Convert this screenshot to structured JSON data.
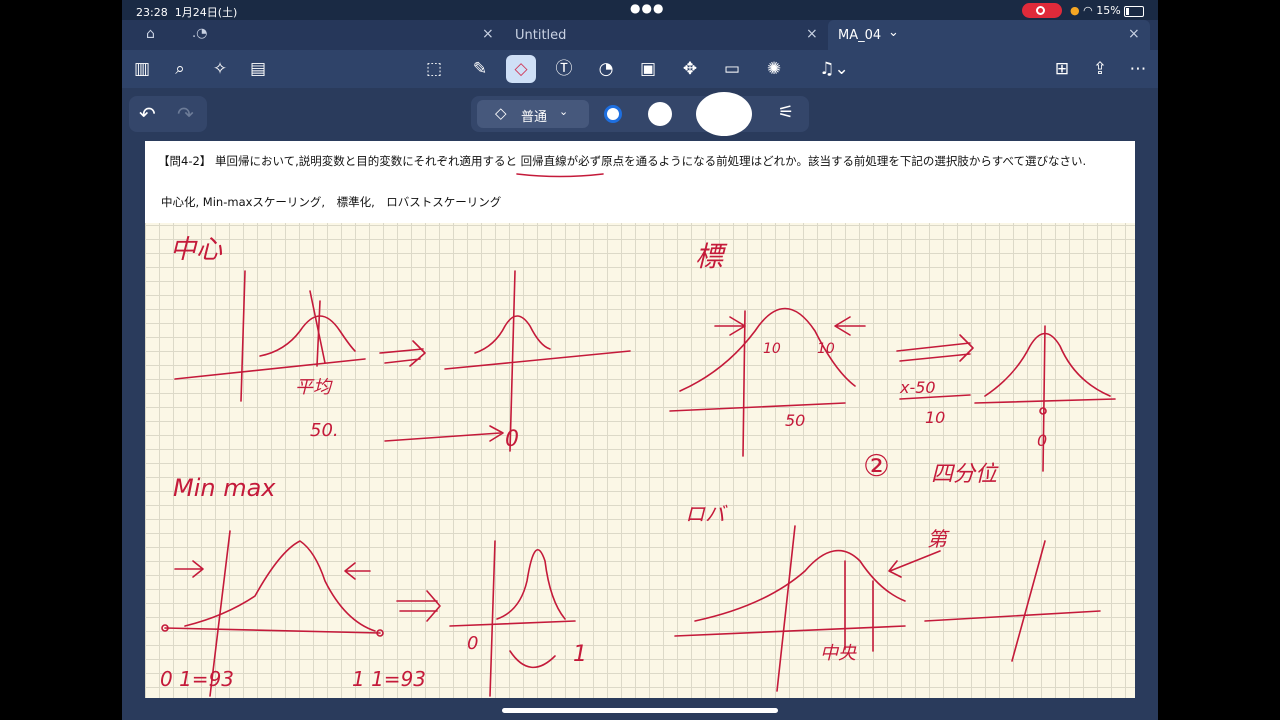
{
  "status": {
    "time": "23:28",
    "date": "1月24日(土)",
    "battery": "15%"
  },
  "tabs": [
    {
      "label": "Untitled"
    },
    {
      "label": "MA_04",
      "chevron": "⌄"
    }
  ],
  "toolbar": {
    "tools": [
      "sidebar-icon",
      "search-icon",
      "magic-icon",
      "list-icon",
      "lasso-icon",
      "pen-icon",
      "eraser-icon",
      "text-icon",
      "shape-icon",
      "image-icon",
      "elements-icon",
      "note-icon",
      "laser-icon",
      "mic-icon",
      "add-page-icon",
      "share-icon",
      "more-icon"
    ],
    "selected": "eraser-icon"
  },
  "eraser": {
    "mode_label": "普通"
  },
  "colors": {
    "ink": "#c41a3a",
    "accent": "#1e6fe0",
    "toolbar": "#2f4369"
  },
  "question": {
    "text": "【問4-2】 単回帰において,説明変数と目的変数にそれぞれ適用すると 回帰直線が必ず原点を通るようになる前処理はどれか。該当する前処理を下記の選択肢からすべて選びなさい.",
    "options": "中心化, Min-maxスケーリング,　標準化,　ロバストスケーリング"
  },
  "notes": {
    "t1": "中心",
    "t2": "平均",
    "t3": "50.",
    "t4": "0",
    "t5": "標",
    "t6": "10",
    "t7": "10",
    "t8": "50",
    "t9": "x-50",
    "t10": "10",
    "t11": "0",
    "t12": "②",
    "t13": "四分位",
    "t14": "Min max",
    "t15": "0",
    "t16": "1",
    "t17": "0 1=93",
    "t18": "1 1=93",
    "t19": "ロバ",
    "t20": "中央",
    "t21": "第"
  }
}
